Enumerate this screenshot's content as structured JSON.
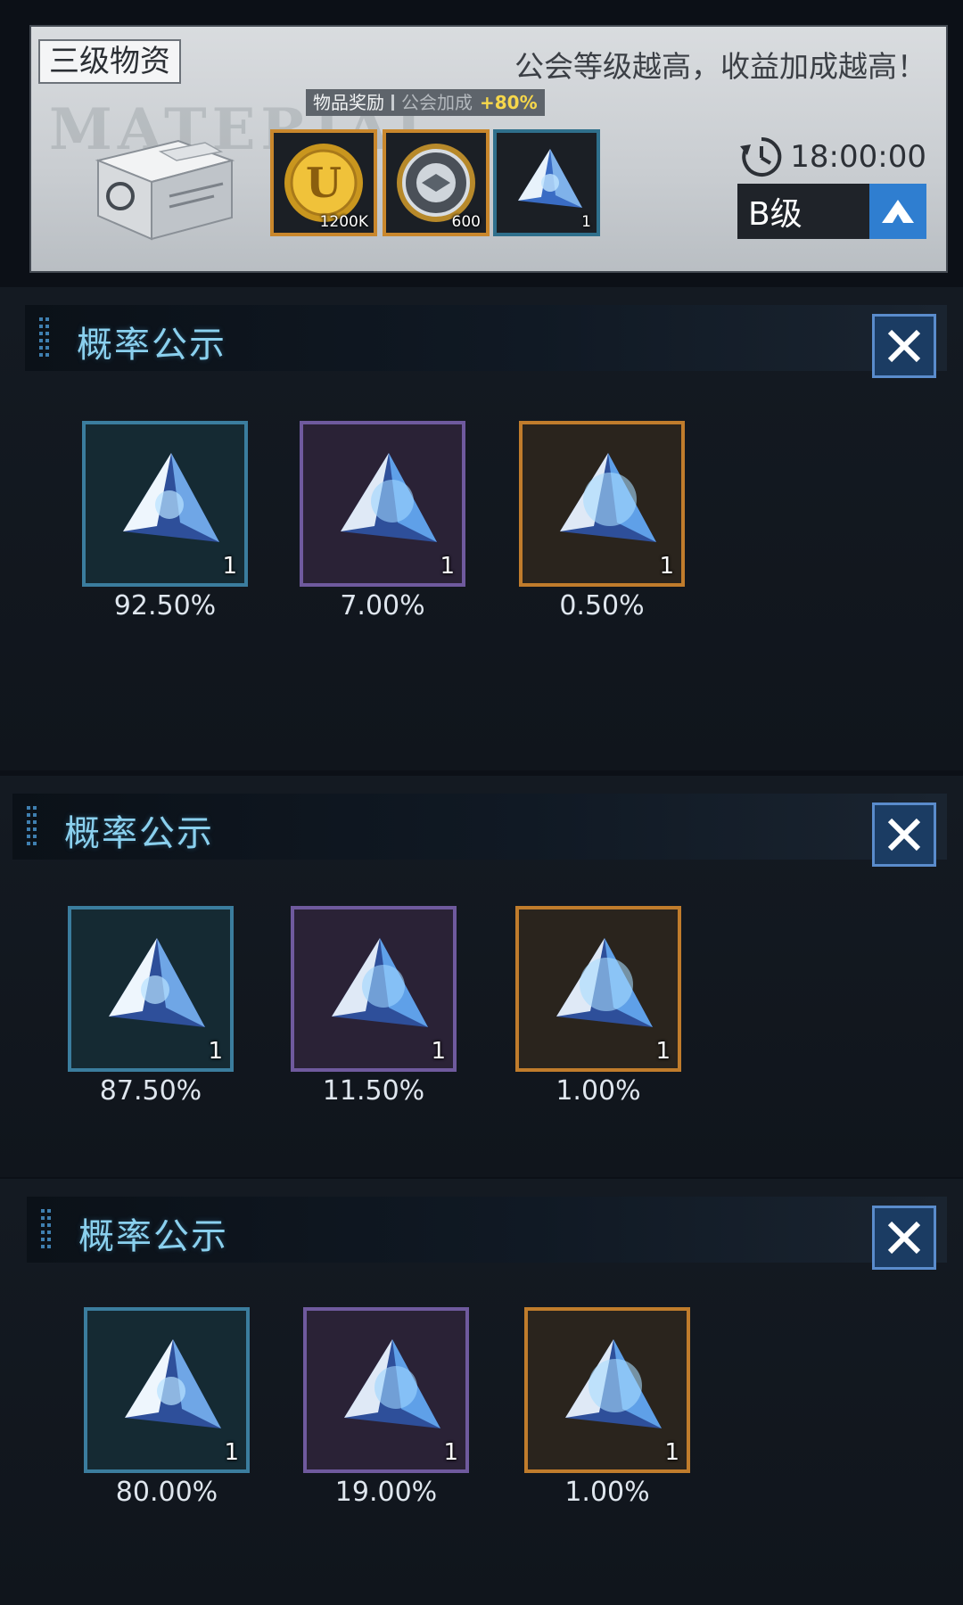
{
  "top": {
    "tier_label": "三级物资",
    "slogan": "公会等级越高，收益加成越高！",
    "watermark": "MATERIAL",
    "bonus": {
      "item_reward": "物品奖励",
      "guild_bonus": "公会加成",
      "bonus_value": "+80%"
    },
    "rewards": [
      {
        "icon": "gold-coin-icon",
        "qty": "1200K"
      },
      {
        "icon": "shield-badge-coin-icon",
        "qty": "600"
      },
      {
        "icon": "crystal-icon",
        "qty": "1"
      }
    ],
    "timer": "18:00:00",
    "grade": "B级"
  },
  "panels": [
    {
      "title": "概率公示",
      "items": [
        {
          "rarity": "blue",
          "qty": "1",
          "pct": "92.50%"
        },
        {
          "rarity": "purple",
          "qty": "1",
          "pct": "7.00%"
        },
        {
          "rarity": "orange",
          "qty": "1",
          "pct": "0.50%"
        }
      ]
    },
    {
      "title": "概率公示",
      "items": [
        {
          "rarity": "blue",
          "qty": "1",
          "pct": "87.50%"
        },
        {
          "rarity": "purple",
          "qty": "1",
          "pct": "11.50%"
        },
        {
          "rarity": "orange",
          "qty": "1",
          "pct": "1.00%"
        }
      ]
    },
    {
      "title": "概率公示",
      "items": [
        {
          "rarity": "blue",
          "qty": "1",
          "pct": "80.00%"
        },
        {
          "rarity": "purple",
          "qty": "1",
          "pct": "19.00%"
        },
        {
          "rarity": "orange",
          "qty": "1",
          "pct": "1.00%"
        }
      ]
    }
  ],
  "colors": {
    "blue": "#3b7d9e",
    "purple": "#6f5a9e",
    "orange": "#c07c2c",
    "accent": "#2f7ed0",
    "bonus": "#f6d74b"
  }
}
